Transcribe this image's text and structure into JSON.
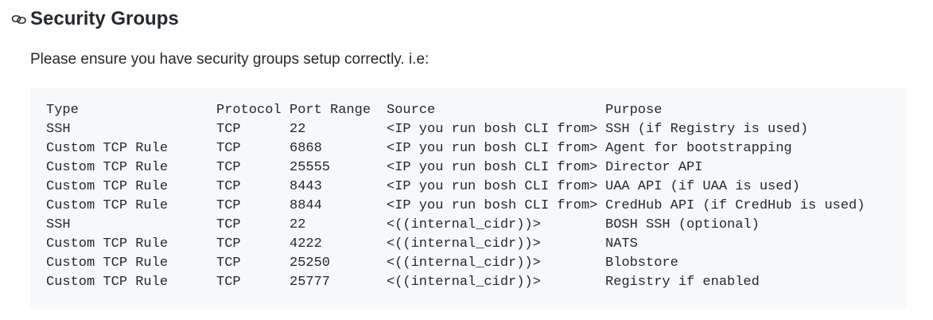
{
  "heading": {
    "icon": "link-icon",
    "title": "Security Groups"
  },
  "intro": "Please ensure you have security groups setup correctly. i.e:",
  "table": {
    "headers": {
      "type": "Type",
      "protocol": "Protocol",
      "port": "Port Range",
      "source": "Source",
      "purpose": "Purpose"
    },
    "rows": [
      {
        "type": "SSH",
        "protocol": "TCP",
        "port": "22",
        "source": "<IP you run bosh CLI from>",
        "purpose": "SSH (if Registry is used)"
      },
      {
        "type": "Custom TCP Rule",
        "protocol": "TCP",
        "port": "6868",
        "source": "<IP you run bosh CLI from>",
        "purpose": "Agent for bootstrapping"
      },
      {
        "type": "Custom TCP Rule",
        "protocol": "TCP",
        "port": "25555",
        "source": "<IP you run bosh CLI from>",
        "purpose": "Director API"
      },
      {
        "type": "Custom TCP Rule",
        "protocol": "TCP",
        "port": "8443",
        "source": "<IP you run bosh CLI from>",
        "purpose": "UAA API (if UAA is used)"
      },
      {
        "type": "Custom TCP Rule",
        "protocol": "TCP",
        "port": "8844",
        "source": "<IP you run bosh CLI from>",
        "purpose": "CredHub API (if CredHub is used)"
      },
      {
        "type": "SSH",
        "protocol": "TCP",
        "port": "22",
        "source": "<((internal_cidr))>",
        "purpose": "BOSH SSH (optional)"
      },
      {
        "type": "Custom TCP Rule",
        "protocol": "TCP",
        "port": "4222",
        "source": "<((internal_cidr))>",
        "purpose": "NATS"
      },
      {
        "type": "Custom TCP Rule",
        "protocol": "TCP",
        "port": "25250",
        "source": "<((internal_cidr))>",
        "purpose": "Blobstore"
      },
      {
        "type": "Custom TCP Rule",
        "protocol": "TCP",
        "port": "25777",
        "source": "<((internal_cidr))>",
        "purpose": "Registry if enabled"
      }
    ]
  }
}
